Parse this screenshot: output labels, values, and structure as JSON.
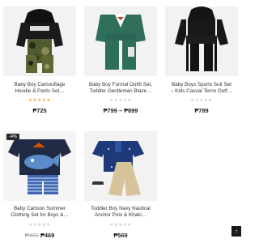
{
  "products": [
    {
      "name_line1": "Baby Boy Camouflage",
      "name_line2": "Hoodie & Pants Set…",
      "rating_filled": true,
      "price": "₱725"
    },
    {
      "name_line1": "Baby Boy Formal Outfit Set,",
      "name_line2": "Toddler Gentleman Blaze…",
      "rating_filled": false,
      "price": "₱799 – ₱899"
    },
    {
      "name_line1": "Baby Boys Sports Suit Set",
      "name_line2": "– Kids Casual Terno Outf…",
      "rating_filled": false,
      "price": "₱789"
    },
    {
      "badge": "-4%",
      "name_line1": "Baby Cartoon Summer",
      "name_line2": "Clothing Set for Boys &…",
      "rating_filled": false,
      "old_price": "₱489",
      "price": "₱469"
    },
    {
      "name_line1": "Toddler Boy Navy Nautical",
      "name_line2": "Anchor Polo & Khaki…",
      "rating_filled": false,
      "price": "₱569"
    }
  ],
  "stars_text": "★★★★★",
  "colors": {
    "star_filled": "#f0a63b",
    "star_empty": "#cfcfcf",
    "badge_bg": "#2a2a2a"
  },
  "back_to_top_icon": "arrow-up-icon",
  "back_to_top_glyph": "↑"
}
